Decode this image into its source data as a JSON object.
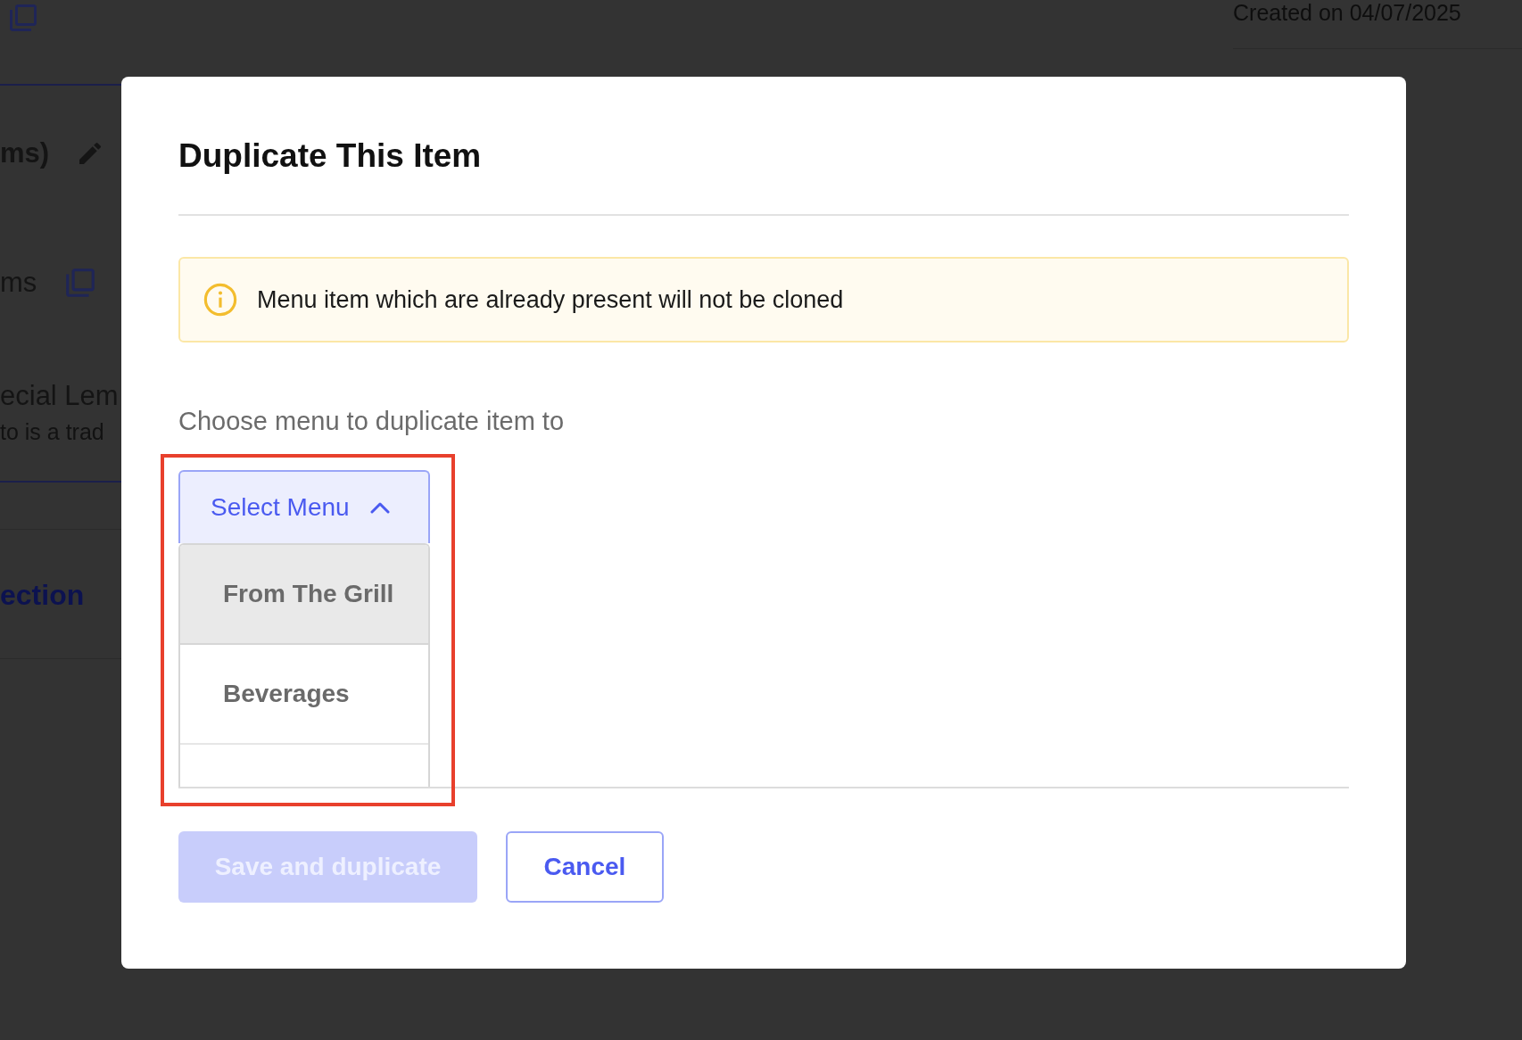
{
  "background_page": {
    "created_on": "Created on 04/07/2025",
    "title_fragment": "ms)",
    "items_fragment": "ms",
    "item_name": "ecial Lem",
    "item_description": "to is a trad",
    "section_link": "ection"
  },
  "dialog": {
    "title": "Duplicate This Item",
    "notice": {
      "kind": "info",
      "text": "Menu item which are already present will not be cloned"
    },
    "label": "Choose menu to duplicate item to",
    "select": {
      "label": "Select Menu",
      "expanded": true,
      "options": [
        {
          "label": "From The Grill",
          "selected": true
        },
        {
          "label": "Beverages",
          "selected": false
        }
      ]
    },
    "buttons": [
      {
        "label": "Save and duplicate",
        "kind": "primary",
        "disabled": true
      },
      {
        "label": "Cancel",
        "kind": "secondary",
        "disabled": false
      }
    ]
  }
}
